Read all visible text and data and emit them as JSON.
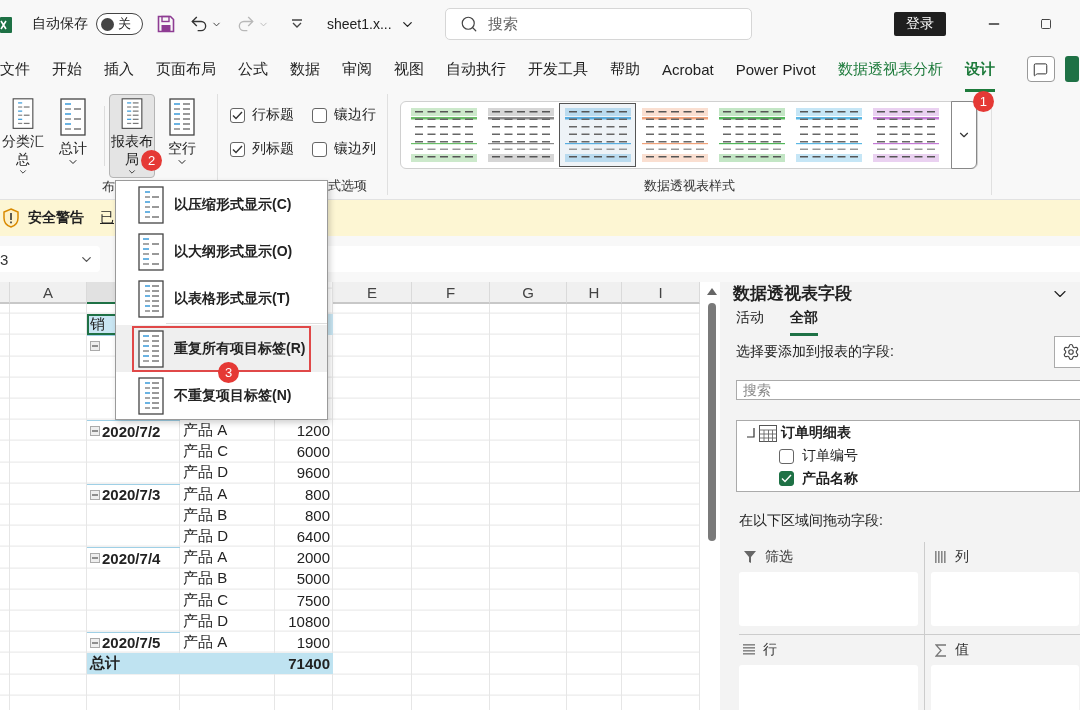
{
  "title_bar": {
    "autosave_label": "自动保存",
    "autosave_toggle": {
      "label": "关",
      "on": false
    },
    "redo": {
      "disabled": true
    },
    "filename": "sheet1.x...",
    "search": {
      "placeholder": "搜索"
    },
    "sign_in": "登录"
  },
  "menu_tabs": [
    {
      "label": "文件",
      "kind": "standard",
      "selected": false
    },
    {
      "label": "开始",
      "kind": "standard",
      "selected": false
    },
    {
      "label": "插入",
      "kind": "standard",
      "selected": false
    },
    {
      "label": "页面布局",
      "kind": "standard",
      "selected": false
    },
    {
      "label": "公式",
      "kind": "standard",
      "selected": false
    },
    {
      "label": "数据",
      "kind": "standard",
      "selected": false
    },
    {
      "label": "审阅",
      "kind": "standard",
      "selected": false
    },
    {
      "label": "视图",
      "kind": "standard",
      "selected": false
    },
    {
      "label": "自动执行",
      "kind": "standard",
      "selected": false
    },
    {
      "label": "开发工具",
      "kind": "standard",
      "selected": false
    },
    {
      "label": "帮助",
      "kind": "standard",
      "selected": false
    },
    {
      "label": "Acrobat",
      "kind": "standard",
      "selected": false
    },
    {
      "label": "Power Pivot",
      "kind": "standard",
      "selected": false
    },
    {
      "label": "数据透视表分析",
      "kind": "contextual",
      "selected": false
    },
    {
      "label": "设计",
      "kind": "contextual",
      "selected": true,
      "badge": "1"
    }
  ],
  "ribbon": {
    "layout_group": {
      "label": "布",
      "buttons": [
        {
          "label": "分类汇总",
          "selected": false
        },
        {
          "label": "总计",
          "selected": false
        },
        {
          "label": "报表布局",
          "selected": true,
          "badge": "2"
        },
        {
          "label": "空行",
          "selected": false
        }
      ]
    },
    "options_group": {
      "label": "式选项",
      "checkboxes": [
        {
          "label": "行标题",
          "checked": true
        },
        {
          "label": "镶边行",
          "checked": false
        },
        {
          "label": "列标题",
          "checked": true
        },
        {
          "label": "镶边列",
          "checked": false
        }
      ]
    },
    "styles_group": {
      "label": "数据透视表样式",
      "styles": [
        {
          "color": "#6cbf6a",
          "selected": false
        },
        {
          "color": "#8a8a8a",
          "selected": false
        },
        {
          "color": "#5aaee0",
          "selected": true
        },
        {
          "color": "#f0a27a",
          "selected": false
        },
        {
          "color": "#52b75a",
          "selected": false
        },
        {
          "color": "#5cb8e4",
          "selected": false
        },
        {
          "color": "#c47ad6",
          "selected": false
        }
      ]
    }
  },
  "security_bar": {
    "title": "安全警告",
    "message": "已"
  },
  "name_box": {
    "value": "3"
  },
  "sheet": {
    "columns": [
      {
        "label": "A",
        "selected": false
      },
      {
        "selected": true
      },
      {},
      {},
      {
        "label": "E",
        "selected": false
      },
      {
        "label": "F",
        "selected": false
      },
      {
        "label": "G",
        "selected": false
      },
      {
        "label": "H",
        "selected": false
      },
      {
        "label": "I",
        "selected": false
      }
    ],
    "pivot": {
      "header": "销",
      "rows": [
        {
          "expanded": true
        },
        {},
        {},
        {},
        {
          "expanded": true,
          "date": "2020/7/2",
          "product": "产品 A",
          "value": "1200"
        },
        {
          "product": "产品 C",
          "value": "6000"
        },
        {
          "product": "产品 D",
          "value": "9600"
        },
        {
          "expanded": true,
          "date": "2020/7/3",
          "product": "产品 A",
          "value": "800"
        },
        {
          "product": "产品 B",
          "value": "800"
        },
        {
          "product": "产品 D",
          "value": "6400"
        },
        {
          "expanded": true,
          "date": "2020/7/4",
          "product": "产品 A",
          "value": "2000"
        },
        {
          "product": "产品 B",
          "value": "5000"
        },
        {
          "product": "产品 C",
          "value": "7500"
        },
        {
          "product": "产品 D",
          "value": "10800"
        },
        {
          "expanded": true,
          "date": "2020/7/5",
          "product": "产品 A",
          "value": "1900"
        }
      ],
      "total": {
        "label": "总计",
        "value": "71400"
      }
    }
  },
  "layout_menu": {
    "groups": [
      [
        {
          "label": "以压缩形式显示(C)",
          "highlighted": false
        },
        {
          "label": "以大纲形式显示(O)",
          "highlighted": false
        },
        {
          "label": "以表格形式显示(T)",
          "highlighted": false
        }
      ],
      [
        {
          "label": "重复所有项目标签(R)",
          "highlighted": true,
          "badge": "3"
        },
        {
          "label": "不重复项目标签(N)",
          "highlighted": false
        }
      ]
    ]
  },
  "field_panel": {
    "title": "数据透视表字段",
    "tabs": [
      {
        "label": "活动",
        "selected": false
      },
      {
        "label": "全部",
        "selected": true
      }
    ],
    "prompt": "选择要添加到报表的字段:",
    "search": {
      "placeholder": "搜索"
    },
    "tree": {
      "table": "订单明细表",
      "expanded": true,
      "fields": [
        {
          "label": "订单编号",
          "checked": false
        },
        {
          "label": "产品名称",
          "checked": true
        }
      ]
    },
    "areas_prompt": "在以下区域间拖动字段:",
    "areas": [
      {
        "kind": "filter",
        "label": "筛选"
      },
      {
        "kind": "columns",
        "label": "列"
      },
      {
        "kind": "rows",
        "label": "行"
      },
      {
        "kind": "values",
        "label": "值"
      }
    ]
  }
}
